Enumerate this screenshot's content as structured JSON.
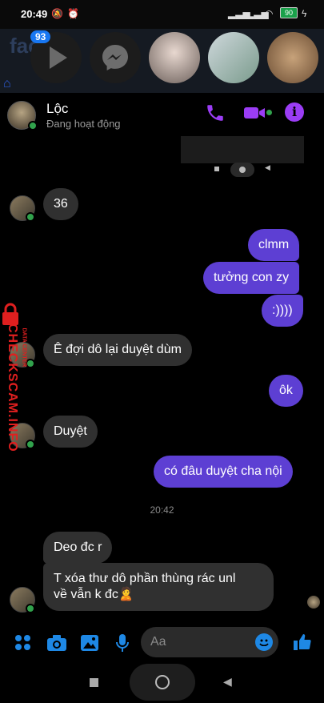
{
  "status_bar": {
    "time": "20:49",
    "battery": "90"
  },
  "bg_app": {
    "badge": "93",
    "logo_text": "faceb"
  },
  "chat": {
    "contact_name": "Lộc",
    "contact_status": "Đang hoạt động"
  },
  "messages": {
    "m1": "36",
    "m2": "clmm",
    "m3": "tưởng con zy",
    "m4": ":))))",
    "m5": "Ê đợi dô lại duyệt dùm",
    "m6": "ôk",
    "m7": "Duyệt",
    "m8": "có đâu duyệt cha nội",
    "timestamp": "20:42",
    "m9": "Deo đc r",
    "m10_line1": "T xóa thư dô phần thùng rác unl",
    "m10_line2": "về vẫn k đc🙎"
  },
  "composer": {
    "placeholder": "Aa"
  },
  "watermark": {
    "main": "CHECKSCAM.INFO",
    "sub": "DATA CENTER"
  },
  "colors": {
    "accent": "#9b3df5",
    "outgoing": "#5d3fd3",
    "incoming": "#303030",
    "online": "#31a24c",
    "blue": "#1e88e5"
  }
}
